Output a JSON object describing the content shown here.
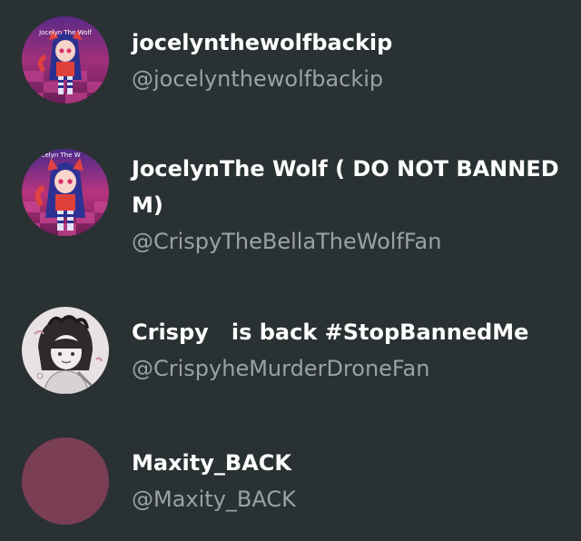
{
  "users": [
    {
      "display_name": "jocelynthewolfbackip",
      "handle": "@jocelynthewolfbackip",
      "avatar_icon": "gacha-character-avatar",
      "avatar_caption": "Jocelyn The Wolf"
    },
    {
      "display_name": "JocelynThe Wolf ( DO NOT BANNED M)",
      "handle": "@CrispyTheBellaTheWolfFan",
      "avatar_icon": "gacha-character-avatar",
      "avatar_caption": "Jocelyn The W"
    },
    {
      "display_name": "Crispy   is back #StopBannedMe",
      "handle": "@CrispyheMurderDroneFan",
      "avatar_icon": "sketch-drawing-avatar"
    },
    {
      "display_name": "Maxity_BACK",
      "handle": "@Maxity_BACK",
      "avatar_icon": "default-color-avatar"
    }
  ],
  "colors": {
    "background": "#2a3133",
    "name": "#ffffff",
    "handle": "#9aa2a4",
    "default_avatar": "#7a3e55"
  }
}
